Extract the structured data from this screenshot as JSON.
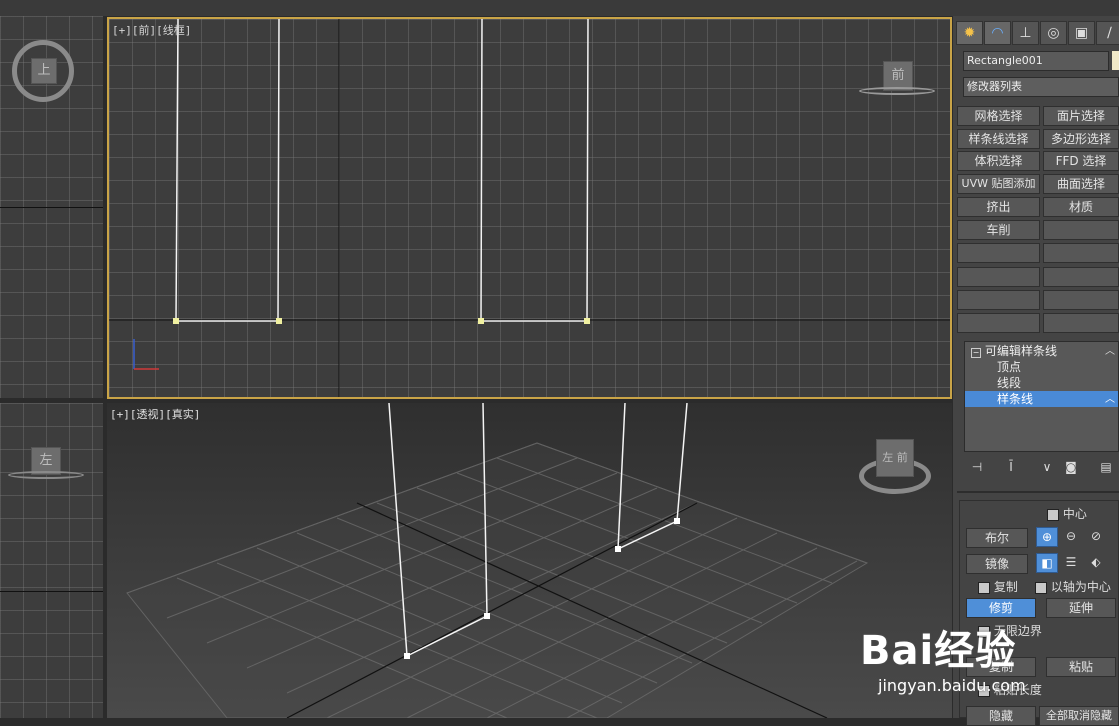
{
  "viewports": {
    "front": {
      "label": "[+][前][线框]",
      "cube_label": "前"
    },
    "perspective": {
      "label": "[+][透视][真实]",
      "cube_label": "左 前"
    },
    "top_left": {
      "cube_label": "上"
    },
    "left": {
      "cube_label": "左"
    }
  },
  "command_panel": {
    "tabs": [
      "create-icon",
      "modify-icon",
      "hierarchy-icon",
      "motion-icon",
      "display-icon",
      "utilities-icon"
    ],
    "object_name": "Rectangle001",
    "modifier_list": "修改器列表",
    "modifier_buttons": [
      [
        "网格选择",
        "面片选择"
      ],
      [
        "样条线选择",
        "多边形选择"
      ],
      [
        "体积选择",
        "FFD 选择"
      ],
      [
        "UVW 贴图添加",
        "曲面选择"
      ],
      [
        "挤出",
        "材质"
      ],
      [
        "车削",
        ""
      ]
    ],
    "stack": {
      "root": "可编辑样条线",
      "items": [
        "顶点",
        "线段",
        "样条线"
      ],
      "selected": "样条线"
    },
    "geometry": {
      "center_label": "中心",
      "boolean_label": "布尔",
      "mirror_label": "镜像",
      "copy_label": "复制",
      "about_pivot_label": "以轴为中心",
      "trim_label": "修剪",
      "extend_label": "延伸",
      "infinite_bounds_label": "无限边界",
      "copy2_label": "复制",
      "paste_label": "粘贴",
      "paste_length_label": "粘贴长度",
      "hide_label": "隐藏",
      "unhide_all_label": "全部取消隐藏"
    }
  },
  "watermark": {
    "text": "Bai经验",
    "url": "jingyan.baidu.com"
  },
  "colors": {
    "accent": "#4f8fd8",
    "viewport_active_border": "#c9a447",
    "spline": "#ffffff"
  }
}
